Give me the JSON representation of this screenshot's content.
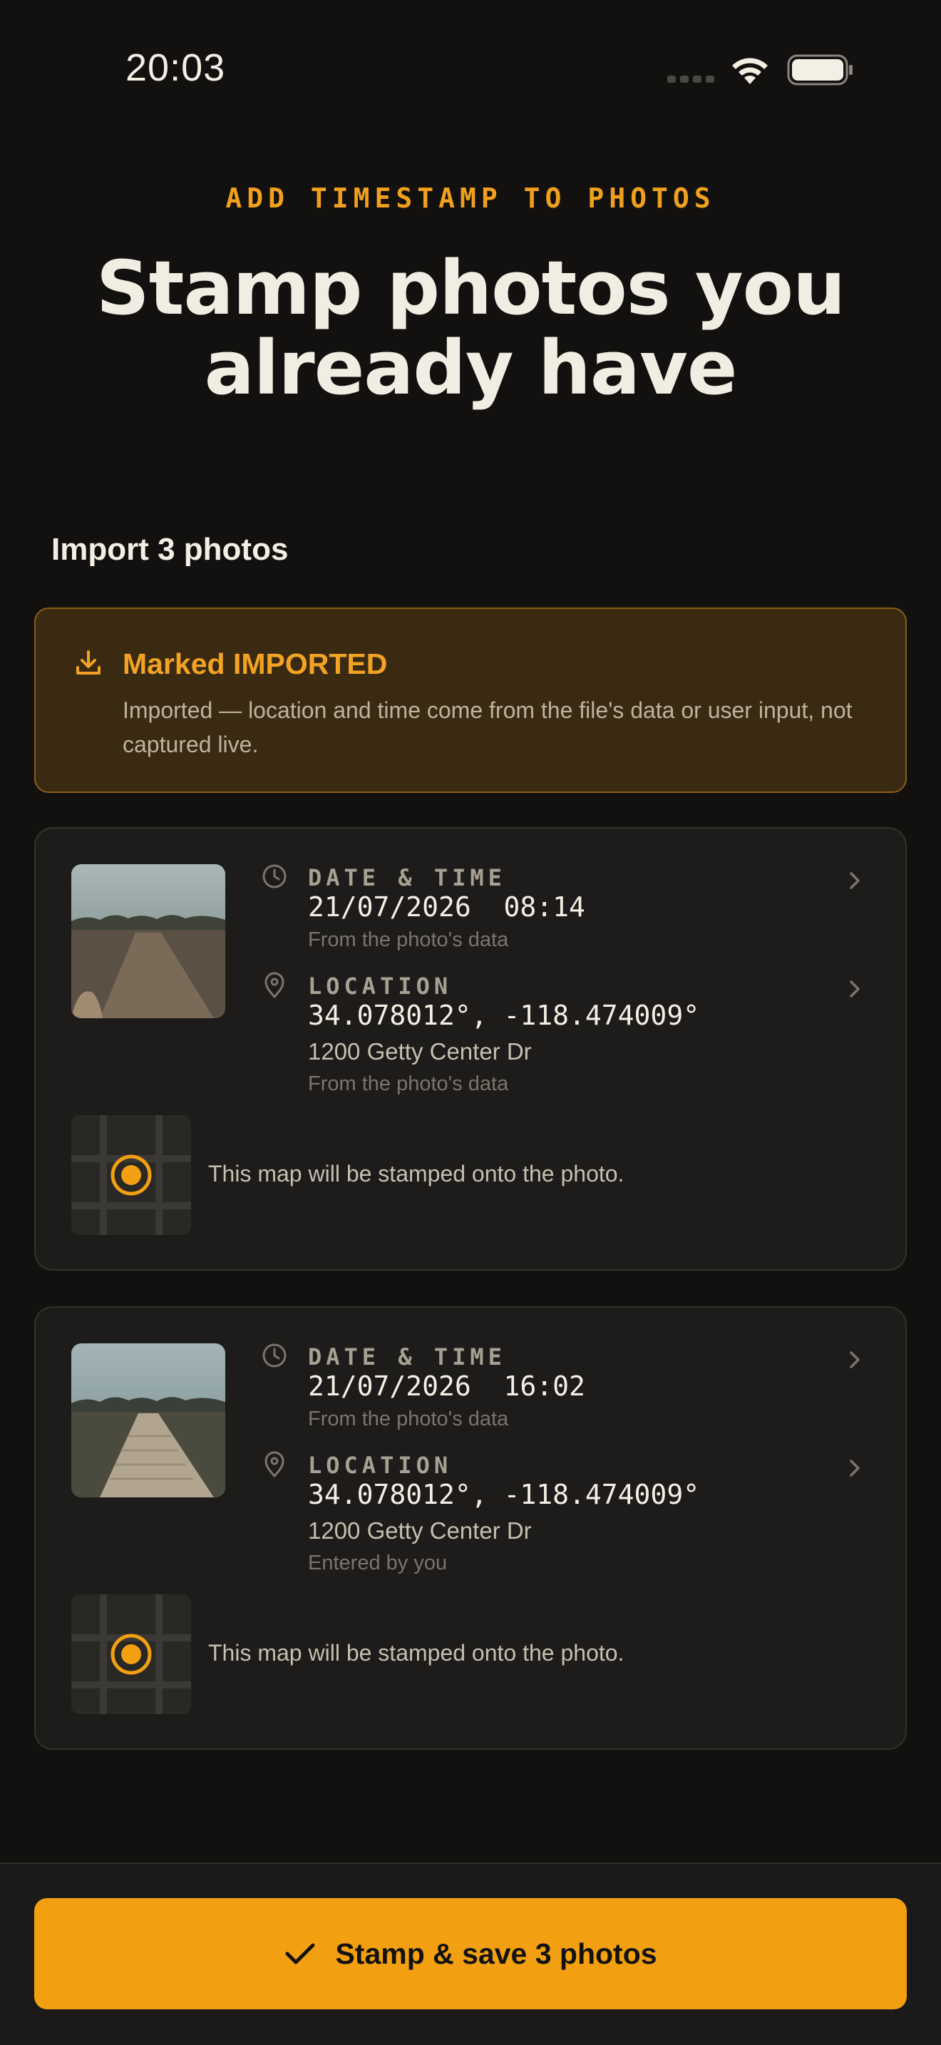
{
  "status_bar": {
    "time": "20:03"
  },
  "header": {
    "eyebrow": "ADD TIMESTAMP TO PHOTOS",
    "headline_line1": "Stamp photos you",
    "headline_line2": "already have"
  },
  "section": {
    "title": "Import 3 photos"
  },
  "banner": {
    "icon": "download-icon",
    "title": "Marked IMPORTED",
    "text": "Imported — location and time come from the file's data or user input, not captured live."
  },
  "photos": [
    {
      "date_label": "DATE & TIME",
      "date_value": "21/07/2026  08:14",
      "date_source": "From the photo's data",
      "location_label": "LOCATION",
      "coordinates": "34.078012°, -118.474009°",
      "address": "1200 Getty Center Dr",
      "location_source": "From the photo's data",
      "map_caption": "This map will be stamped onto the photo."
    },
    {
      "date_label": "DATE & TIME",
      "date_value": "21/07/2026  16:02",
      "date_source": "From the photo's data",
      "location_label": "LOCATION",
      "coordinates": "34.078012°, -118.474009°",
      "address": "1200 Getty Center Dr",
      "location_source": "Entered by you",
      "map_caption": "This map will be stamped onto the photo."
    }
  ],
  "cta": {
    "icon": "checkmark-icon",
    "label": "Stamp & save 3 photos"
  },
  "colors": {
    "accent": "#f2a012",
    "background": "#121110",
    "card": "#1d1c1a",
    "banner_bg": "#3a2a12"
  }
}
